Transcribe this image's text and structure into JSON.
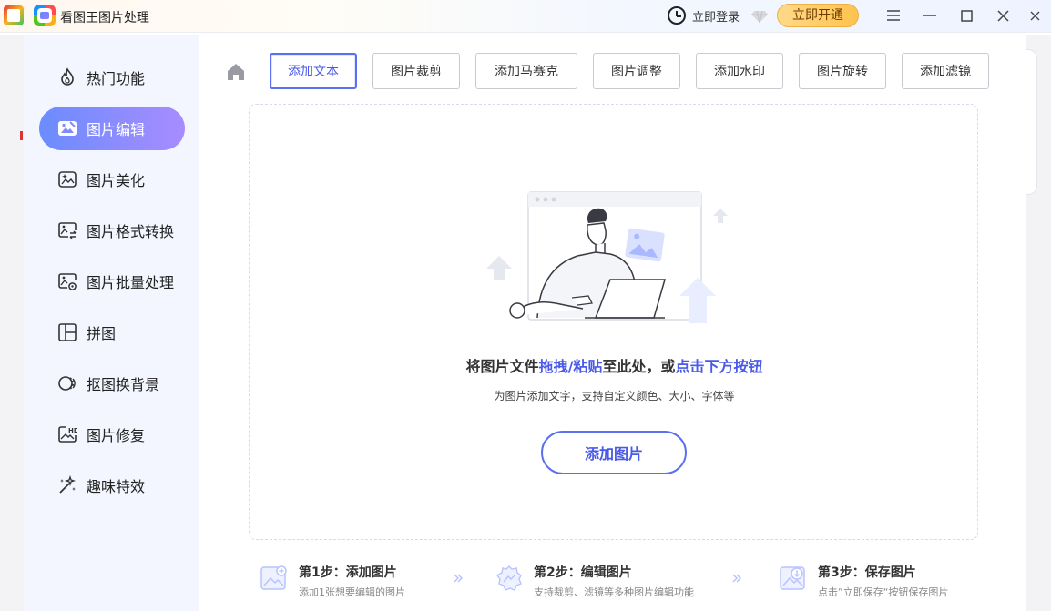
{
  "app": {
    "title": "看图王图片处理"
  },
  "header": {
    "login_label": "立即登录",
    "vip_label": "立即开通"
  },
  "sidebar": {
    "items": [
      {
        "label": "热门功能",
        "icon": "fire-icon"
      },
      {
        "label": "图片编辑",
        "icon": "image-edit-icon",
        "active": true
      },
      {
        "label": "图片美化",
        "icon": "image-sparkle-icon"
      },
      {
        "label": "图片格式转换",
        "icon": "image-convert-icon"
      },
      {
        "label": "图片批量处理",
        "icon": "image-batch-icon"
      },
      {
        "label": "拼图",
        "icon": "collage-icon"
      },
      {
        "label": "抠图换背景",
        "icon": "cutout-icon"
      },
      {
        "label": "图片修复",
        "icon": "hd-image-icon"
      },
      {
        "label": "趣味特效",
        "icon": "magic-wand-icon"
      }
    ]
  },
  "tabs": [
    {
      "label": "添加文本",
      "active": true
    },
    {
      "label": "图片裁剪"
    },
    {
      "label": "添加马赛克"
    },
    {
      "label": "图片调整"
    },
    {
      "label": "添加水印"
    },
    {
      "label": "图片旋转"
    },
    {
      "label": "添加滤镜"
    }
  ],
  "drop_zone": {
    "title_part1": "将图片文件",
    "title_hl1": "拖拽/粘贴",
    "title_part2": "至此处，或",
    "title_hl2": "点击下方按钮",
    "subtitle": "为图片添加文字，支持自定义颜色、大小、字体等",
    "button_label": "添加图片"
  },
  "steps": [
    {
      "title": "第1步：添加图片",
      "desc": "添加1张想要编辑的图片"
    },
    {
      "title": "第2步：编辑图片",
      "desc": "支持裁剪、滤镜等多种图片编辑功能"
    },
    {
      "title": "第3步：保存图片",
      "desc": "点击”立即保存“按钮保存图片"
    }
  ],
  "colors": {
    "accent": "#5b6ff0",
    "sidebar_bg": "#f3f6ff",
    "vip": "#ffc34d"
  }
}
